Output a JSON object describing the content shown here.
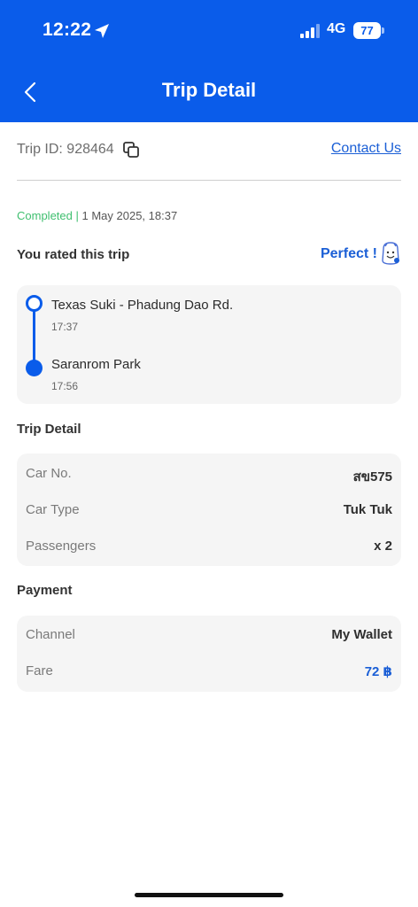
{
  "status_bar": {
    "time": "12:22",
    "network": "4G",
    "battery": "77"
  },
  "header": {
    "title": "Trip Detail"
  },
  "trip": {
    "id_text": "Trip ID: 928464",
    "contact_label": "Contact Us",
    "status": "Completed",
    "separator": "|",
    "datetime": " 1 May 2025, 18:37",
    "rated_label": "You rated this trip",
    "rating": "Perfect !"
  },
  "route": {
    "pickup": {
      "name": "Texas Suki - Phadung Dao Rd.",
      "time": "17:37"
    },
    "dropoff": {
      "name": "Saranrom Park",
      "time": "17:56"
    }
  },
  "trip_detail": {
    "heading": "Trip Detail",
    "rows": [
      {
        "label": "Car No.",
        "value": "สข575"
      },
      {
        "label": "Car Type",
        "value": "Tuk Tuk"
      },
      {
        "label": "Passengers",
        "value": "x 2"
      }
    ]
  },
  "payment": {
    "heading": "Payment",
    "rows": [
      {
        "label": "Channel",
        "value": "My Wallet"
      },
      {
        "label": "Fare",
        "value": "72 ฿"
      }
    ]
  },
  "colors": {
    "primary": "#0a5cea",
    "link": "#1b5fd6",
    "completed": "#3fbf6f",
    "card_bg": "#f5f5f5"
  },
  "icons": [
    "location-arrow-icon",
    "signal-icon",
    "battery-icon",
    "back-chevron-icon",
    "copy-icon",
    "smiley-face-icon"
  ]
}
